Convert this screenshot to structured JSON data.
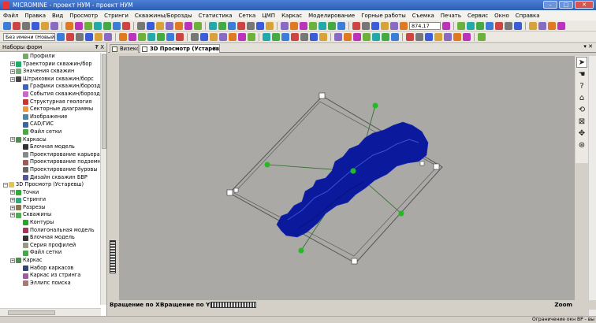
{
  "window": {
    "title": "MICROMINE - проект НУМ - проект НУМ"
  },
  "menu": [
    "Файл",
    "Правка",
    "Вид",
    "Просмотр",
    "Стринги",
    "Скважины/Борозды",
    "Статистика",
    "Сетка",
    "ЦМП",
    "Каркас",
    "Моделирование",
    "Горные работы",
    "Съемка",
    "Печать",
    "Сервис",
    "Окно",
    "Справка"
  ],
  "toolbar": {
    "zoom_value": "874,17",
    "project_combo": "Без имени (Новый карк.."
  },
  "panel": {
    "title": "Наборы форм",
    "pin": "₮ X"
  },
  "tree": [
    {
      "label": "Профили",
      "level": 2,
      "exp": "",
      "color": "#7a6"
    },
    {
      "label": "Траектории скважин/бор",
      "level": 1,
      "exp": "+",
      "color": "#2a6"
    },
    {
      "label": "Значения скважин",
      "level": 1,
      "exp": "+",
      "color": "#7a7"
    },
    {
      "label": "Штриховки скважин/борс",
      "level": 1,
      "exp": "+",
      "color": "#444"
    },
    {
      "label": "Графики скважин/борозд",
      "level": 2,
      "exp": "",
      "color": "#36c"
    },
    {
      "label": "События скважин/борозд",
      "level": 2,
      "exp": "",
      "color": "#c6c"
    },
    {
      "label": "Структурная геология",
      "level": 2,
      "exp": "",
      "color": "#c33"
    },
    {
      "label": "Секторные диаграммы",
      "level": 2,
      "exp": "",
      "color": "#e93"
    },
    {
      "label": "Изображение",
      "level": 2,
      "exp": "",
      "color": "#48a"
    },
    {
      "label": "CAD/ГИС",
      "level": 2,
      "exp": "",
      "color": "#36a"
    },
    {
      "label": "Файл сетки",
      "level": 2,
      "exp": "",
      "color": "#4a4"
    },
    {
      "label": "Каркасы",
      "level": 1,
      "exp": "+",
      "color": "#585"
    },
    {
      "label": "Блочная модель",
      "level": 2,
      "exp": "",
      "color": "#333"
    },
    {
      "label": "Проектирование карьера",
      "level": 2,
      "exp": "",
      "color": "#888"
    },
    {
      "label": "Проектирование подземн",
      "level": 2,
      "exp": "",
      "color": "#a55"
    },
    {
      "label": "Проектирование буровы",
      "level": 2,
      "exp": "",
      "color": "#666"
    },
    {
      "label": "Дизайн скважин БВР",
      "level": 2,
      "exp": "",
      "color": "#559"
    },
    {
      "label": "3D Просмотр (Устаревш)",
      "level": 0,
      "exp": "−",
      "color": "#e8c24a"
    },
    {
      "label": "Точки",
      "level": 1,
      "exp": "+",
      "color": "#3a3"
    },
    {
      "label": "Стринги",
      "level": 1,
      "exp": "+",
      "color": "#3a7"
    },
    {
      "label": "Разрезы",
      "level": 1,
      "exp": "+",
      "color": "#875"
    },
    {
      "label": "Скважины",
      "level": 1,
      "exp": "+",
      "color": "#5a5"
    },
    {
      "label": "Контуры",
      "level": 2,
      "exp": "",
      "color": "#2a2"
    },
    {
      "label": "Полигональная модель",
      "level": 2,
      "exp": "",
      "color": "#a35"
    },
    {
      "label": "Блочная модель",
      "level": 2,
      "exp": "",
      "color": "#333"
    },
    {
      "label": "Серия профилей",
      "level": 2,
      "exp": "",
      "color": "#998"
    },
    {
      "label": "Файл сетки",
      "level": 2,
      "exp": "",
      "color": "#4a4"
    },
    {
      "label": "Каркас",
      "level": 1,
      "exp": "+",
      "color": "#585"
    },
    {
      "label": "Набор каркасов",
      "level": 2,
      "exp": "",
      "color": "#347"
    },
    {
      "label": "Каркас из стринга",
      "level": 2,
      "exp": "",
      "color": "#a5a"
    },
    {
      "label": "Эллипс поиска",
      "level": 2,
      "exp": "",
      "color": "#a77"
    }
  ],
  "tabs": [
    {
      "label": "Визекс",
      "active": false
    },
    {
      "label": "3D Просмотр (Устаревш)",
      "active": true
    }
  ],
  "view": {
    "rotate_x": "Вращение по X",
    "rotate_y": "Вращение по Y",
    "zoom": "Zoom"
  },
  "status": {
    "text": "Ограничение окн  ВР - вы"
  },
  "colors": {
    "model": "#0b1a9c",
    "handle": "#22bb22",
    "frame": "#555555"
  }
}
